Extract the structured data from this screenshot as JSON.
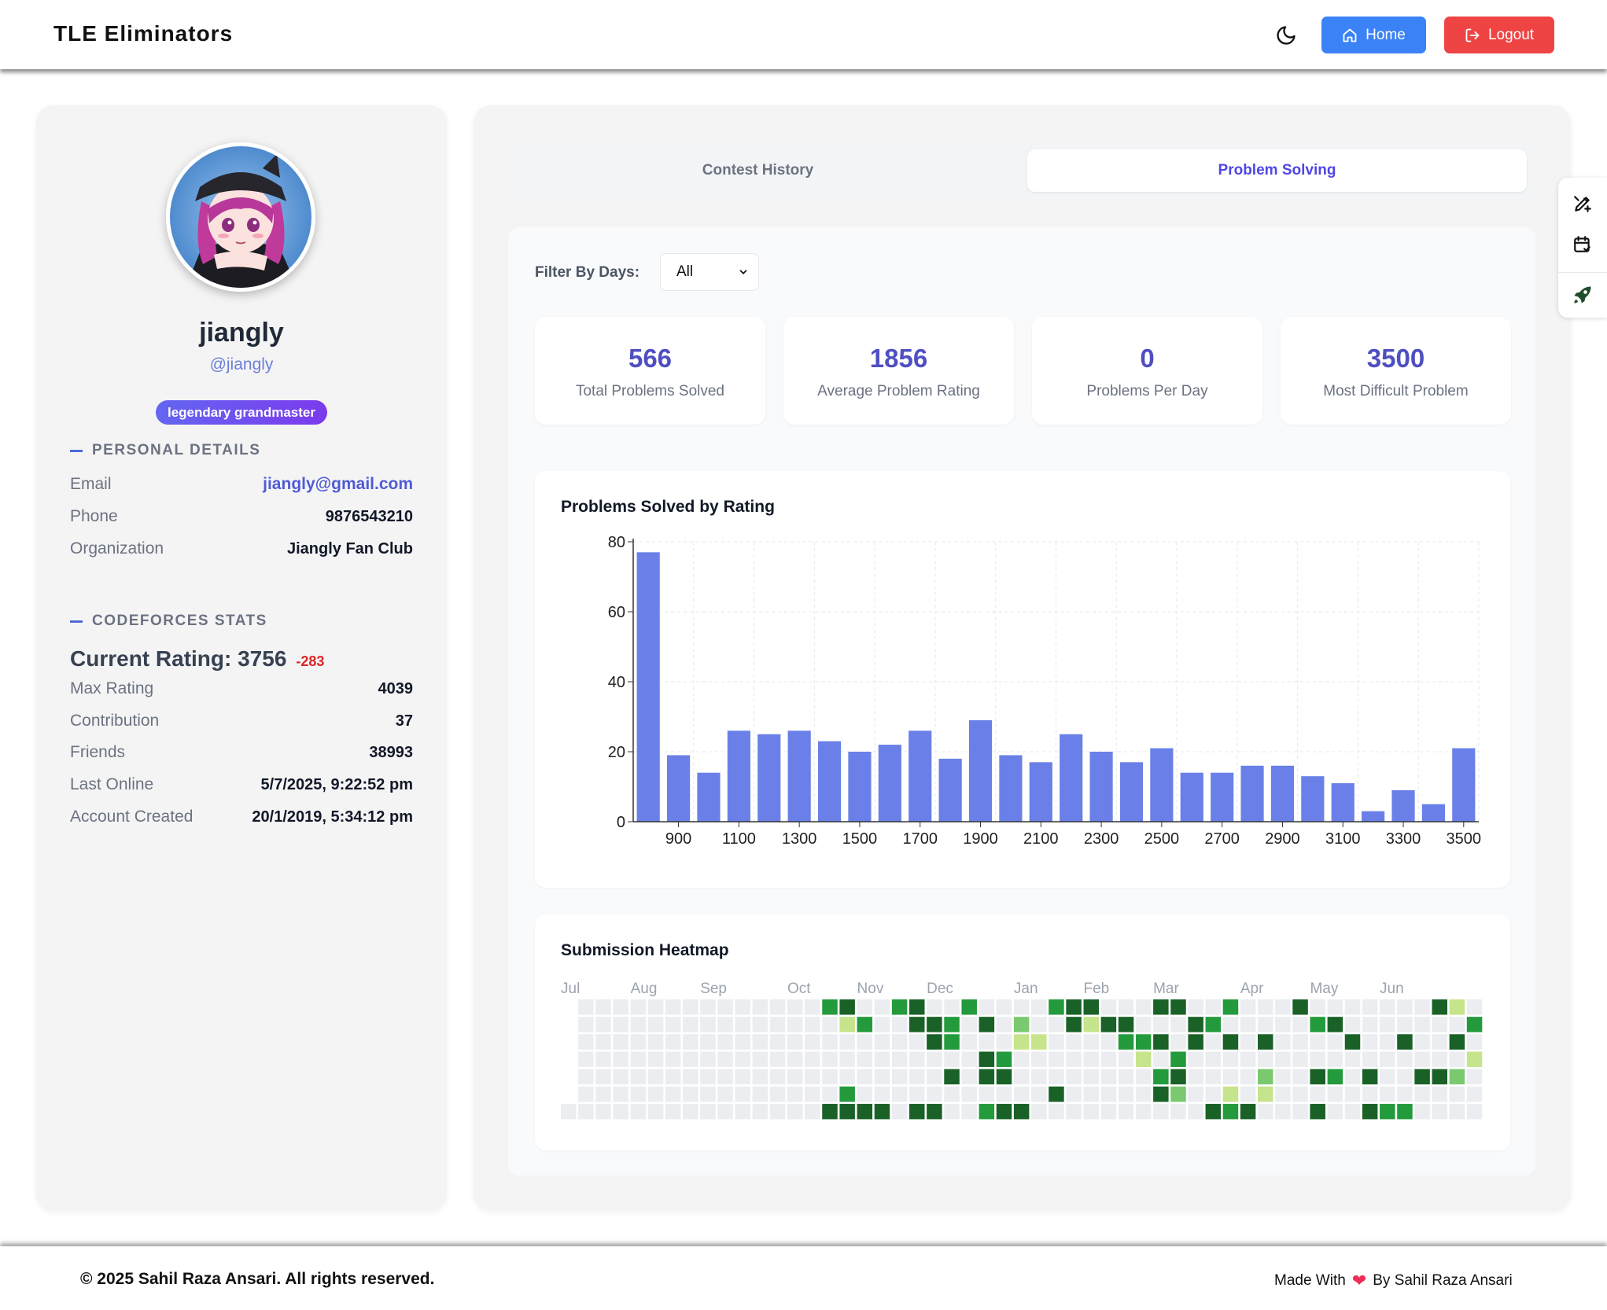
{
  "header": {
    "brand": "TLE Eliminators",
    "home_label": "Home",
    "logout_label": "Logout",
    "theme_icon": "moon-icon"
  },
  "profile": {
    "name": "jiangly",
    "handle": "@jiangly",
    "rank": "legendary grandmaster",
    "personal_title": "PERSONAL DETAILS",
    "personal": [
      {
        "key": "Email",
        "value": "jiangly@gmail.com"
      },
      {
        "key": "Phone",
        "value": "9876543210"
      },
      {
        "key": "Organization",
        "value": "Jiangly Fan Club"
      }
    ],
    "cf_title": "CODEFORCES STATS",
    "current_rating_label": "Current Rating: 3756",
    "rating_delta": "-283",
    "stats": [
      {
        "key": "Max Rating",
        "value": "4039"
      },
      {
        "key": "Contribution",
        "value": "37"
      },
      {
        "key": "Friends",
        "value": "38993"
      },
      {
        "key": "Last Online",
        "value": "5/7/2025, 9:22:52 pm"
      },
      {
        "key": "Account Created",
        "value": "20/1/2019, 5:34:12 pm"
      }
    ]
  },
  "tabs": [
    "Contest History",
    "Problem Solving"
  ],
  "active_tab": "Problem Solving",
  "filter": {
    "label": "Filter By Days:",
    "value": "All"
  },
  "summary": [
    {
      "value": "566",
      "label": "Total Problems Solved"
    },
    {
      "value": "1856",
      "label": "Average Problem Rating"
    },
    {
      "value": "0",
      "label": "Problems Per Day"
    },
    {
      "value": "3500",
      "label": "Most Difficult Problem"
    }
  ],
  "chart_data": {
    "type": "bar",
    "title": "Problems Solved by Rating",
    "xlabel": "",
    "ylabel": "",
    "ylim": [
      0,
      80
    ],
    "yticks": [
      0,
      20,
      40,
      60,
      80
    ],
    "categories": [
      800,
      900,
      1000,
      1100,
      1200,
      1300,
      1400,
      1500,
      1600,
      1700,
      1800,
      1900,
      2000,
      2100,
      2200,
      2300,
      2400,
      2500,
      2600,
      2700,
      2800,
      2900,
      3000,
      3100,
      3200,
      3300,
      3400,
      3500
    ],
    "xtick_labels": [
      "900",
      "1100",
      "1300",
      "1500",
      "1700",
      "1900",
      "2100",
      "2300",
      "2500",
      "2700",
      "2900",
      "3100",
      "3300",
      "3500"
    ],
    "values": [
      77,
      19,
      14,
      26,
      25,
      26,
      23,
      20,
      22,
      26,
      18,
      29,
      19,
      17,
      25,
      20,
      17,
      21,
      14,
      14,
      16,
      16,
      13,
      11,
      3,
      9,
      5,
      21
    ],
    "color": "#6a80e8",
    "grid": true
  },
  "heatmap": {
    "title": "Submission Heatmap",
    "months": [
      {
        "label": "Jul",
        "week": 0
      },
      {
        "label": "Aug",
        "week": 4
      },
      {
        "label": "Sep",
        "week": 8
      },
      {
        "label": "Oct",
        "week": 13
      },
      {
        "label": "Nov",
        "week": 17
      },
      {
        "label": "Dec",
        "week": 21
      },
      {
        "label": "Jan",
        "week": 26
      },
      {
        "label": "Feb",
        "week": 30
      },
      {
        "label": "Mar",
        "week": 34
      },
      {
        "label": "Apr",
        "week": 39
      },
      {
        "label": "May",
        "week": 43
      },
      {
        "label": "Jun",
        "week": 47
      }
    ],
    "weeks": 53,
    "first_week_start_day": 6,
    "colors": [
      "#ebedf0",
      "#c6e48b",
      "#7bc96f",
      "#239a3b",
      "#196127"
    ],
    "cells": [
      [
        15,
        0,
        3
      ],
      [
        15,
        6,
        4
      ],
      [
        16,
        0,
        4
      ],
      [
        16,
        1,
        1
      ],
      [
        16,
        5,
        3
      ],
      [
        16,
        6,
        4
      ],
      [
        17,
        1,
        3
      ],
      [
        17,
        6,
        4
      ],
      [
        18,
        6,
        4
      ],
      [
        19,
        0,
        3
      ],
      [
        20,
        0,
        4
      ],
      [
        20,
        1,
        4
      ],
      [
        20,
        6,
        4
      ],
      [
        21,
        1,
        4
      ],
      [
        21,
        2,
        4
      ],
      [
        21,
        6,
        4
      ],
      [
        22,
        1,
        3
      ],
      [
        22,
        2,
        3
      ],
      [
        22,
        4,
        4
      ],
      [
        23,
        0,
        3
      ],
      [
        24,
        1,
        4
      ],
      [
        24,
        3,
        4
      ],
      [
        24,
        4,
        4
      ],
      [
        24,
        6,
        3
      ],
      [
        25,
        3,
        3
      ],
      [
        25,
        4,
        4
      ],
      [
        25,
        6,
        4
      ],
      [
        26,
        1,
        2
      ],
      [
        26,
        2,
        1
      ],
      [
        26,
        6,
        4
      ],
      [
        27,
        2,
        1
      ],
      [
        28,
        0,
        3
      ],
      [
        28,
        5,
        4
      ],
      [
        29,
        0,
        4
      ],
      [
        29,
        1,
        4
      ],
      [
        30,
        0,
        4
      ],
      [
        30,
        1,
        1
      ],
      [
        31,
        1,
        4
      ],
      [
        32,
        1,
        4
      ],
      [
        32,
        2,
        3
      ],
      [
        33,
        2,
        3
      ],
      [
        33,
        3,
        1
      ],
      [
        34,
        0,
        4
      ],
      [
        34,
        2,
        4
      ],
      [
        34,
        4,
        3
      ],
      [
        34,
        5,
        4
      ],
      [
        35,
        0,
        4
      ],
      [
        35,
        3,
        3
      ],
      [
        35,
        4,
        4
      ],
      [
        35,
        5,
        2
      ],
      [
        36,
        1,
        4
      ],
      [
        36,
        2,
        4
      ],
      [
        37,
        1,
        3
      ],
      [
        37,
        6,
        4
      ],
      [
        38,
        0,
        3
      ],
      [
        38,
        2,
        4
      ],
      [
        38,
        5,
        1
      ],
      [
        38,
        6,
        3
      ],
      [
        39,
        6,
        4
      ],
      [
        40,
        2,
        4
      ],
      [
        40,
        4,
        2
      ],
      [
        40,
        5,
        1
      ],
      [
        42,
        0,
        4
      ],
      [
        43,
        1,
        3
      ],
      [
        43,
        4,
        4
      ],
      [
        43,
        6,
        4
      ],
      [
        44,
        1,
        4
      ],
      [
        44,
        4,
        3
      ],
      [
        45,
        2,
        4
      ],
      [
        46,
        4,
        4
      ],
      [
        46,
        6,
        4
      ],
      [
        47,
        6,
        3
      ],
      [
        48,
        2,
        4
      ],
      [
        48,
        6,
        3
      ],
      [
        49,
        4,
        4
      ],
      [
        50,
        0,
        4
      ],
      [
        50,
        4,
        4
      ],
      [
        51,
        0,
        1
      ],
      [
        51,
        2,
        4
      ],
      [
        51,
        4,
        2
      ],
      [
        52,
        1,
        3
      ],
      [
        52,
        3,
        1
      ]
    ]
  },
  "dock": [
    "edit-icon",
    "calendar-icon",
    "rocket-icon"
  ],
  "footer": {
    "copyright": "© 2025 Sahil Raza Ansari. All rights reserved.",
    "made_with": "Made With",
    "heart": "❤",
    "by": "By Sahil Raza Ansari"
  }
}
